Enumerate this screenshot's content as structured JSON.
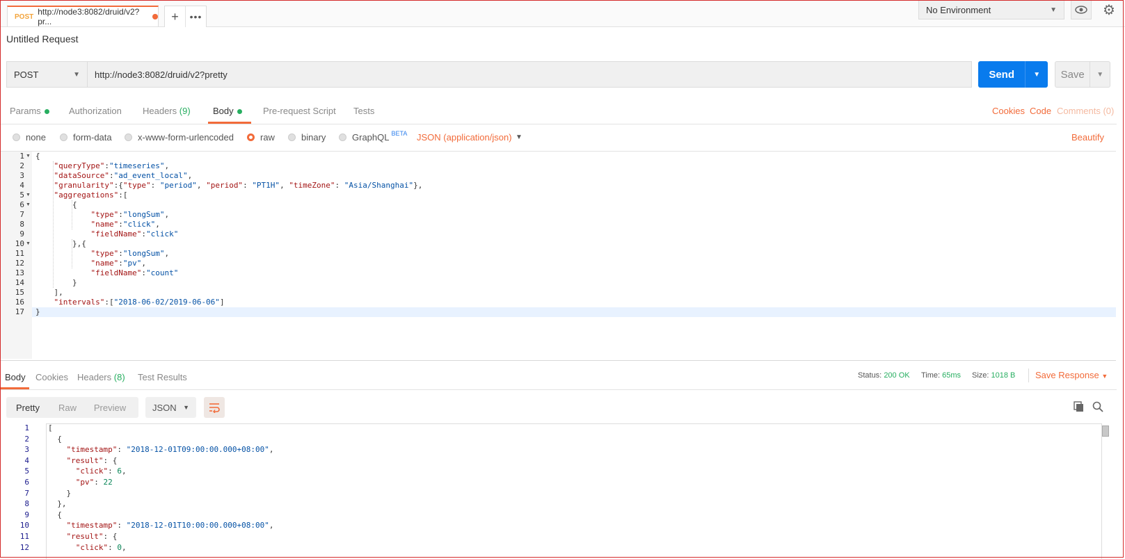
{
  "tab": {
    "method": "POST",
    "url": "http://node3:8082/druid/v2?pr..."
  },
  "env": {
    "label": "No Environment"
  },
  "request_title": "Untitled Request",
  "request": {
    "method": "POST",
    "url": "http://node3:8082/druid/v2?pretty",
    "send_label": "Send",
    "save_label": "Save"
  },
  "req_tabs": {
    "params": "Params",
    "authorization": "Authorization",
    "headers": "Headers",
    "headers_count": "(9)",
    "body": "Body",
    "prerequest": "Pre-request Script",
    "tests": "Tests"
  },
  "req_links": {
    "cookies": "Cookies",
    "code": "Code",
    "comments": "Comments (0)"
  },
  "body_types": {
    "none": "none",
    "form_data": "form-data",
    "urlencoded": "x-www-form-urlencoded",
    "raw": "raw",
    "binary": "binary",
    "graphql": "GraphQL",
    "beta": "BETA"
  },
  "content_type": "JSON (application/json)",
  "beautify": "Beautify",
  "request_body_lines": [
    "{",
    "    \"queryType\":\"timeseries\",",
    "    \"dataSource\":\"ad_event_local\",",
    "    \"granularity\":{\"type\": \"period\", \"period\": \"PT1H\", \"timeZone\": \"Asia/Shanghai\"},",
    "    \"aggregations\":[",
    "        {",
    "            \"type\":\"longSum\",",
    "            \"name\":\"click\",",
    "            \"fieldName\":\"click\"",
    "        },{",
    "            \"type\":\"longSum\",",
    "            \"name\":\"pv\",",
    "            \"fieldName\":\"count\"",
    "        }",
    "    ],",
    "    \"intervals\":[\"2018-06-02/2019-06-06\"]",
    "}"
  ],
  "resp_tabs": {
    "body": "Body",
    "cookies": "Cookies",
    "headers": "Headers",
    "headers_count": "(8)",
    "test_results": "Test Results"
  },
  "resp_meta": {
    "status_label": "Status:",
    "status": "200 OK",
    "time_label": "Time:",
    "time": "65ms",
    "size_label": "Size:",
    "size": "1018 B",
    "save_response": "Save Response"
  },
  "resp_format": {
    "pretty": "Pretty",
    "raw": "Raw",
    "preview": "Preview",
    "lang": "JSON"
  },
  "response_lines": [
    "[",
    "  {",
    "    \"timestamp\": \"2018-12-01T09:00:00.000+08:00\",",
    "    \"result\": {",
    "      \"click\": 6,",
    "      \"pv\": 22",
    "    }",
    "  },",
    "  {",
    "    \"timestamp\": \"2018-12-01T10:00:00.000+08:00\",",
    "    \"result\": {",
    "      \"click\": 0,"
  ]
}
